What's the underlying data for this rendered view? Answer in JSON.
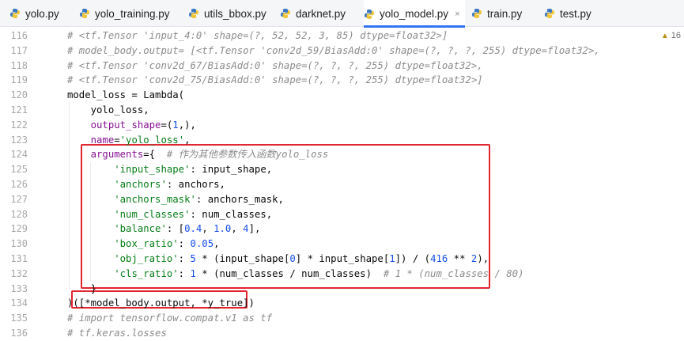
{
  "tabs": [
    {
      "label": "yolo.py",
      "active": false
    },
    {
      "label": "yolo_training.py",
      "active": false
    },
    {
      "label": "utils_bbox.py",
      "active": false
    },
    {
      "label": "darknet.py",
      "active": false
    },
    {
      "label": "yolo_model.py",
      "active": true
    },
    {
      "label": "train.py",
      "active": false
    },
    {
      "label": "test.py",
      "active": false
    }
  ],
  "active_tab_close": "×",
  "warnings": {
    "count": "16"
  },
  "lines": [
    {
      "n": "116",
      "tokens": [
        {
          "t": "# <tf.Tensor 'input_4:0' shape=(?, 52, 52, 3, 85) dtype=float32>]",
          "c": "cm"
        }
      ]
    },
    {
      "n": "117",
      "tokens": [
        {
          "t": "# model_body.output= [<tf.Tensor 'conv2d_59/BiasAdd:0' shape=(?, ?, ?, 255) dtype=float32>,",
          "c": "cm"
        }
      ]
    },
    {
      "n": "118",
      "tokens": [
        {
          "t": "# <tf.Tensor 'conv2d_67/BiasAdd:0' shape=(?, ?, ?, 255) dtype=float32>,",
          "c": "cm"
        }
      ]
    },
    {
      "n": "119",
      "tokens": [
        {
          "t": "# <tf.Tensor 'conv2d_75/BiasAdd:0' shape=(?, ?, ?, 255) dtype=float32>]",
          "c": "cm"
        }
      ]
    },
    {
      "n": "120",
      "tokens": [
        {
          "t": "model_loss = Lambda(",
          "c": ""
        }
      ]
    },
    {
      "n": "121",
      "tokens": [
        {
          "t": "    yolo_loss,",
          "c": ""
        }
      ]
    },
    {
      "n": "122",
      "tokens": [
        {
          "t": "    ",
          "c": ""
        },
        {
          "t": "output_shape",
          "c": "kw"
        },
        {
          "t": "=(",
          "c": ""
        },
        {
          "t": "1",
          "c": "nm"
        },
        {
          "t": ",),",
          "c": ""
        }
      ]
    },
    {
      "n": "123",
      "tokens": [
        {
          "t": "    ",
          "c": ""
        },
        {
          "t": "name",
          "c": "kw"
        },
        {
          "t": "=",
          "c": ""
        },
        {
          "t": "'yolo_loss'",
          "c": "st"
        },
        {
          "t": ",",
          "c": ""
        }
      ]
    },
    {
      "n": "124",
      "tokens": [
        {
          "t": "    ",
          "c": ""
        },
        {
          "t": "arguments",
          "c": "kw"
        },
        {
          "t": "={  ",
          "c": ""
        },
        {
          "t": "# 作为其他参数传入函数yolo_loss",
          "c": "cm"
        }
      ]
    },
    {
      "n": "125",
      "tokens": [
        {
          "t": "        ",
          "c": ""
        },
        {
          "t": "'input_shape'",
          "c": "st"
        },
        {
          "t": ": input_shape,",
          "c": ""
        }
      ]
    },
    {
      "n": "126",
      "tokens": [
        {
          "t": "        ",
          "c": ""
        },
        {
          "t": "'anchors'",
          "c": "st"
        },
        {
          "t": ": anchors,",
          "c": ""
        }
      ]
    },
    {
      "n": "127",
      "tokens": [
        {
          "t": "        ",
          "c": ""
        },
        {
          "t": "'anchors_mask'",
          "c": "st"
        },
        {
          "t": ": anchors_mask,",
          "c": ""
        }
      ]
    },
    {
      "n": "128",
      "tokens": [
        {
          "t": "        ",
          "c": ""
        },
        {
          "t": "'num_classes'",
          "c": "st"
        },
        {
          "t": ": num_classes,",
          "c": ""
        }
      ]
    },
    {
      "n": "129",
      "tokens": [
        {
          "t": "        ",
          "c": ""
        },
        {
          "t": "'balance'",
          "c": "st"
        },
        {
          "t": ": [",
          "c": ""
        },
        {
          "t": "0.4",
          "c": "nm"
        },
        {
          "t": ", ",
          "c": ""
        },
        {
          "t": "1.0",
          "c": "nm"
        },
        {
          "t": ", ",
          "c": ""
        },
        {
          "t": "4",
          "c": "nm"
        },
        {
          "t": "],",
          "c": ""
        }
      ]
    },
    {
      "n": "130",
      "tokens": [
        {
          "t": "        ",
          "c": ""
        },
        {
          "t": "'box_ratio'",
          "c": "st"
        },
        {
          "t": ": ",
          "c": ""
        },
        {
          "t": "0.05",
          "c": "nm"
        },
        {
          "t": ",",
          "c": ""
        }
      ]
    },
    {
      "n": "131",
      "tokens": [
        {
          "t": "        ",
          "c": ""
        },
        {
          "t": "'obj_ratio'",
          "c": "st"
        },
        {
          "t": ": ",
          "c": ""
        },
        {
          "t": "5",
          "c": "nm"
        },
        {
          "t": " * (input_shape[",
          "c": ""
        },
        {
          "t": "0",
          "c": "nm"
        },
        {
          "t": "] * input_shape[",
          "c": ""
        },
        {
          "t": "1",
          "c": "nm"
        },
        {
          "t": "]) / (",
          "c": ""
        },
        {
          "t": "416",
          "c": "nm"
        },
        {
          "t": " ** ",
          "c": ""
        },
        {
          "t": "2",
          "c": "nm"
        },
        {
          "t": "),",
          "c": ""
        }
      ]
    },
    {
      "n": "132",
      "tokens": [
        {
          "t": "        ",
          "c": ""
        },
        {
          "t": "'cls_ratio'",
          "c": "st"
        },
        {
          "t": ": ",
          "c": ""
        },
        {
          "t": "1",
          "c": "nm"
        },
        {
          "t": " * (num_classes / num_classes)  ",
          "c": ""
        },
        {
          "t": "# 1 * (num_classes / 80)",
          "c": "cm"
        }
      ]
    },
    {
      "n": "133",
      "tokens": [
        {
          "t": "    }",
          "c": ""
        }
      ]
    },
    {
      "n": "134",
      "tokens": [
        {
          "t": ")([*model_body.output, *y_true])",
          "c": ""
        }
      ]
    },
    {
      "n": "135",
      "tokens": [
        {
          "t": "# import tensorflow.compat.v1 as tf",
          "c": "cm"
        }
      ]
    },
    {
      "n": "136",
      "tokens": [
        {
          "t": "# tf.keras.losses",
          "c": "cm"
        }
      ]
    }
  ]
}
